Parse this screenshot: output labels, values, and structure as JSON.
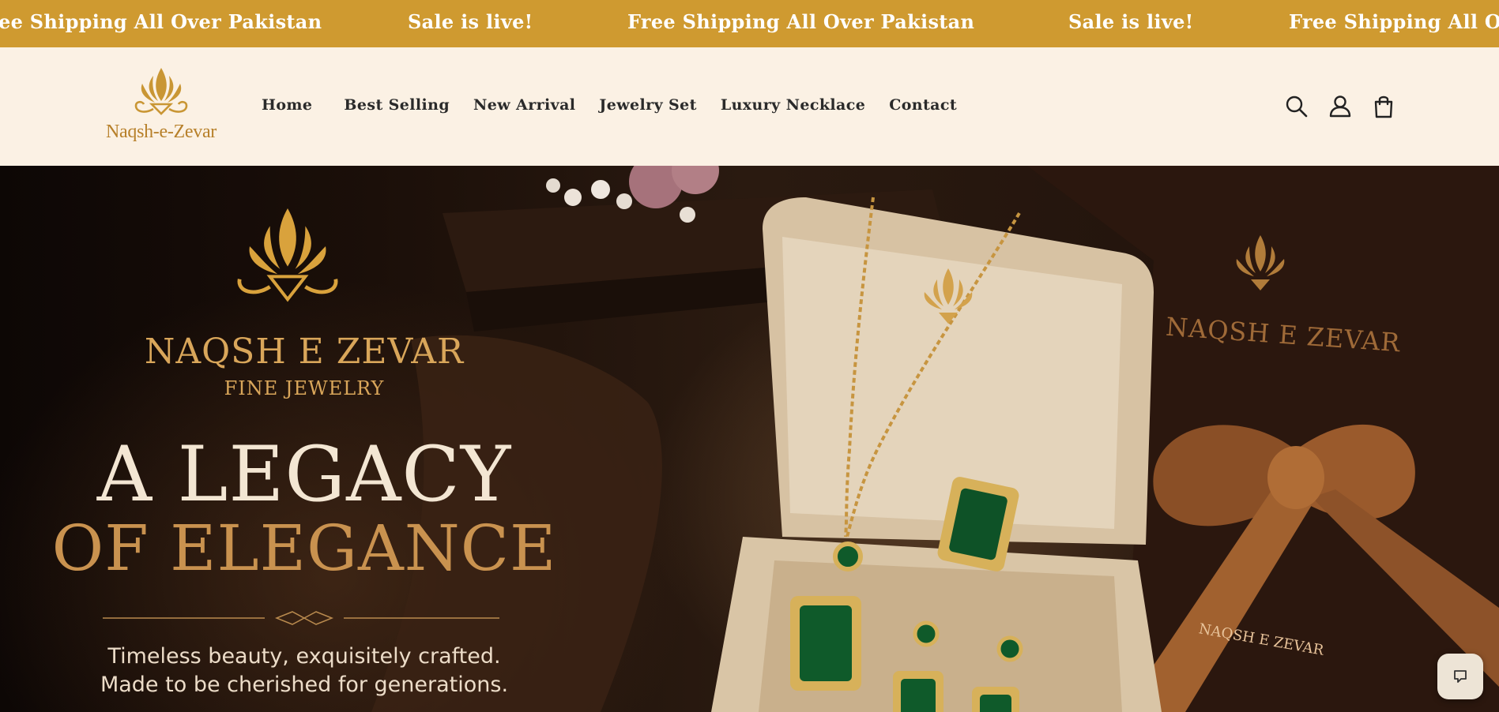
{
  "announcement": {
    "items": [
      "ee Shipping All Over Pakistan",
      "Sale is live!",
      "Free Shipping All Over Pakistan",
      "Sale is live!",
      "Free Shipping All O"
    ]
  },
  "header": {
    "logo_text": "Naqsh-e-Zevar",
    "nav": [
      "Home",
      "Best Selling",
      "New Arrival",
      "Jewelry Set",
      "Luxury Necklace",
      "Contact"
    ],
    "icons": [
      "search-icon",
      "account-icon",
      "cart-icon"
    ]
  },
  "hero": {
    "brand": "NAQSH E ZEVAR",
    "brand_sub": "FINE JEWELRY",
    "title_line1": "A LEGACY",
    "title_line2": "OF ELEGANCE",
    "tagline_line1": "Timeless beauty, exquisitely crafted.",
    "tagline_line2": "Made to be cherished for generations.",
    "bg_brand": "NAQSH E ZEVAR",
    "ribbon_text": "NAQSH E ZEVAR"
  },
  "colors": {
    "announcement_bg": "#cf9a30",
    "header_bg": "#fbf1e4",
    "gold": "#d9a65a",
    "emerald": "#0f5a2a"
  }
}
